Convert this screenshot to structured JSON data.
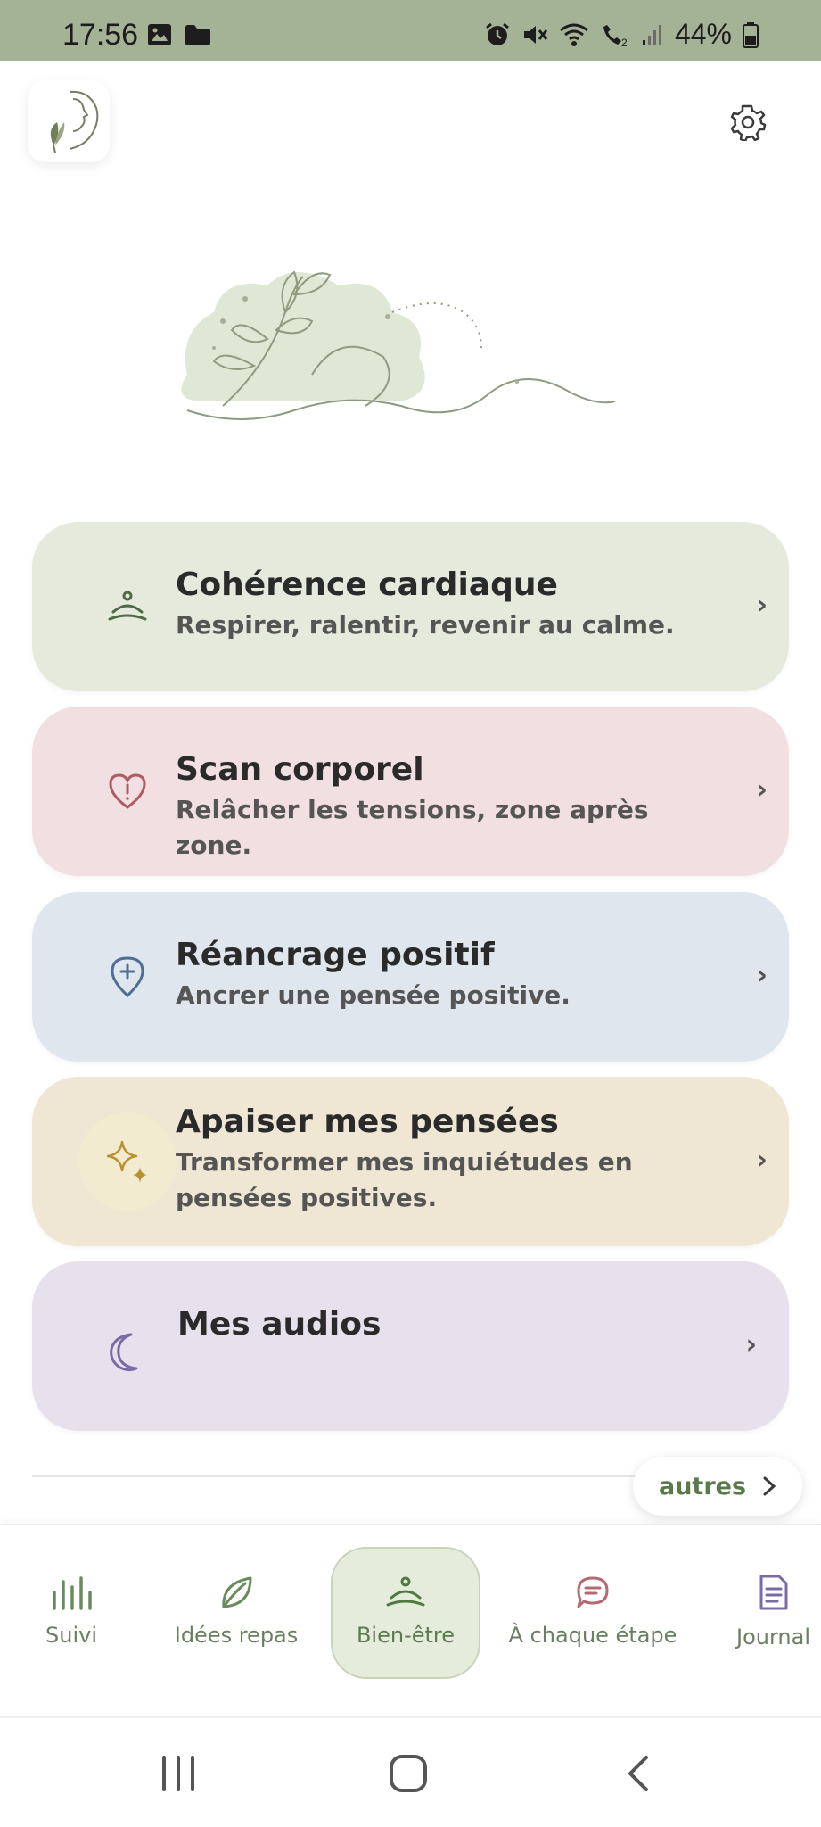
{
  "status_bar": {
    "time": "17:56",
    "battery": "44%"
  },
  "header": {
    "logo_icon": "face-leaf-logo",
    "settings_icon": "gear-icon"
  },
  "cards": [
    {
      "title": "Cohérence cardiaque",
      "subtitle": "Respirer, ralentir, revenir au calme.",
      "icon": "meditation-icon",
      "color": "#e5eadc"
    },
    {
      "title": "Scan corporel",
      "subtitle": "Relâcher les tensions, zone après zone.",
      "icon": "heart-icon",
      "color": "#f2dfe1"
    },
    {
      "title": "Réancrage positif",
      "subtitle": "Ancrer une pensée positive.",
      "icon": "pin-plus-icon",
      "color": "#dfe6ee"
    },
    {
      "title": "Apaiser mes pensées",
      "subtitle": "Transformer mes inquiétudes en pensées positives.",
      "icon": "sparkle-icon",
      "color": "#efe6d4"
    },
    {
      "title": "Mes audios",
      "subtitle": "",
      "icon": "moon-icon",
      "color": "#e6e1ec"
    }
  ],
  "chevron": "›",
  "autres": {
    "label": "autres"
  },
  "nav": {
    "items": [
      {
        "label": "Suivi",
        "icon": "bar-chart-icon"
      },
      {
        "label": "Idées repas",
        "icon": "leaf-icon"
      },
      {
        "label": "Bien-être",
        "icon": "meditation-icon",
        "active": true
      },
      {
        "label": "À chaque étape",
        "icon": "chat-bubble-icon"
      },
      {
        "label": "Journal",
        "icon": "document-icon"
      }
    ]
  },
  "colors": {
    "status_bar": "#a4b396",
    "accent_green": "#6a7f61"
  }
}
